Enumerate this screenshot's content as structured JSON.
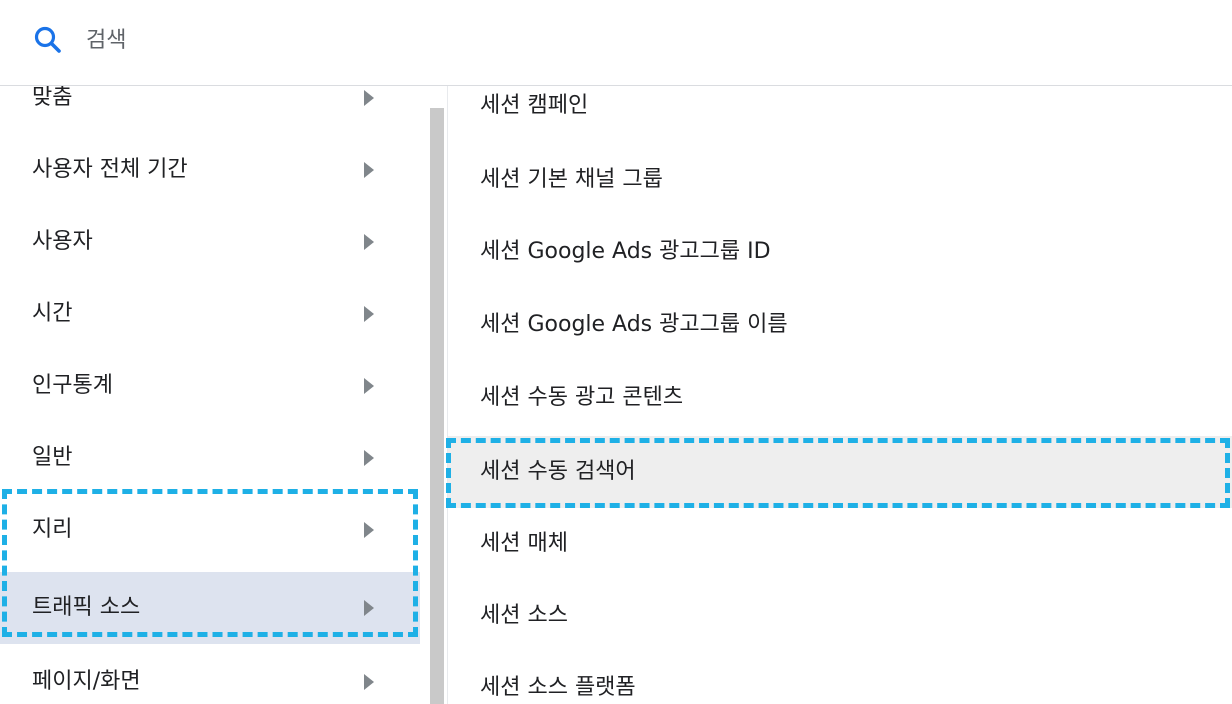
{
  "search": {
    "placeholder": "검색",
    "icon": "search-icon",
    "icon_color": "#1a73e8"
  },
  "categories": [
    {
      "label": "맞춤",
      "arrow": "chevron-right-icon"
    },
    {
      "label": "사용자 전체 기간",
      "arrow": "chevron-right-icon"
    },
    {
      "label": "사용자",
      "arrow": "chevron-right-icon"
    },
    {
      "label": "시간",
      "arrow": "chevron-right-icon"
    },
    {
      "label": "인구통계",
      "arrow": "chevron-right-icon"
    },
    {
      "label": "일반",
      "arrow": "chevron-right-icon"
    },
    {
      "label": "지리",
      "arrow": "chevron-right-icon"
    },
    {
      "label": "트래픽 소스",
      "arrow": "chevron-right-icon",
      "selected": true
    },
    {
      "label": "페이지/화면",
      "arrow": "chevron-right-icon"
    }
  ],
  "dimensions": [
    {
      "label": "세션 캠페인"
    },
    {
      "label": "세션 기본 채널 그룹"
    },
    {
      "label": "세션 Google Ads 광고그룹 ID"
    },
    {
      "label": "세션 Google Ads 광고그룹 이름"
    },
    {
      "label": "세션 수동 광고 콘텐츠"
    },
    {
      "label": "세션 수동 검색어",
      "selected": true
    },
    {
      "label": "세션 매체"
    },
    {
      "label": "세션 소스"
    },
    {
      "label": "세션 소스 플랫폼"
    }
  ],
  "colors": {
    "highlight_dash": "#1eb0e6",
    "selected_category_bg": "#dde3ef",
    "selected_dimension_bg": "#eeeeee",
    "arrow": "#80868b"
  }
}
